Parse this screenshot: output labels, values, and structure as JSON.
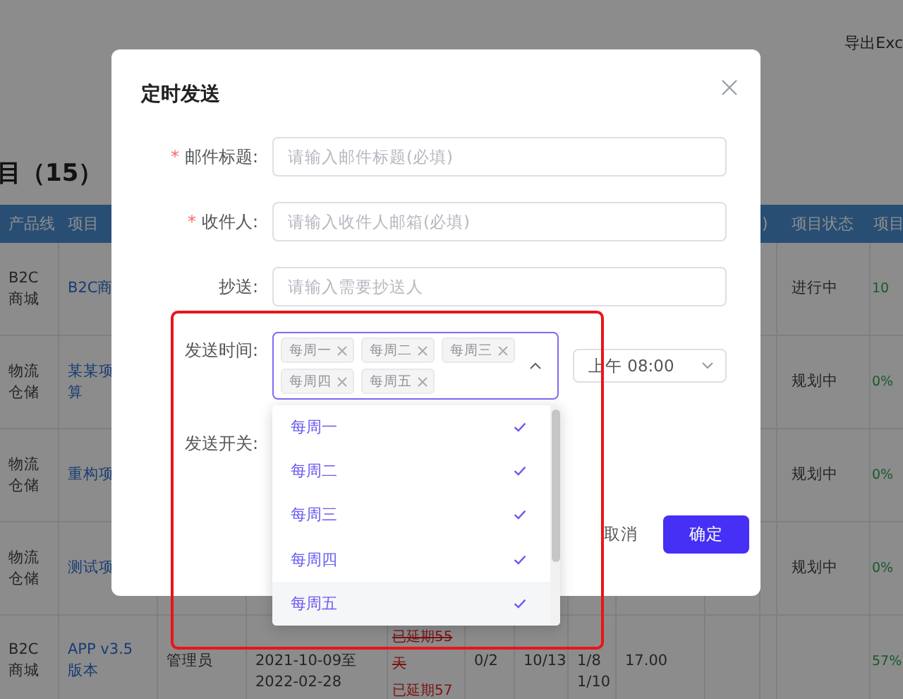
{
  "background": {
    "export_link": "导出Exc",
    "heading": "目（15）",
    "table": {
      "columns": [
        {
          "label": "产品线",
          "kind": "text"
        },
        {
          "label": "项目",
          "kind": "link"
        },
        {
          "kind": "text"
        },
        {
          "kind": "text"
        },
        {
          "kind": "delays"
        },
        {
          "kind": "text"
        },
        {
          "kind": "text"
        },
        {
          "kind": "text"
        },
        {
          "kind": "text"
        },
        {
          "kind": "text"
        },
        {
          "label": ")",
          "kind": "text"
        },
        {
          "label": "项目状态",
          "kind": "text"
        },
        {
          "label": "项目",
          "kind": "progress"
        }
      ],
      "rows": [
        {
          "cells": [
            "B2C商城",
            "B2C商",
            "",
            "",
            "",
            "",
            "",
            "",
            "",
            "",
            "",
            "进行中",
            "10"
          ]
        },
        {
          "cells": [
            "物流仓储",
            "某某项算",
            "",
            "",
            "",
            "",
            "",
            "",
            "",
            "",
            "",
            "规划中",
            "0%"
          ]
        },
        {
          "cells": [
            "物流仓储",
            "重构项",
            "",
            "",
            "",
            "",
            "",
            "",
            "",
            "",
            "",
            "规划中",
            "0%"
          ]
        },
        {
          "cells": [
            "物流仓储",
            "测试项",
            "",
            "",
            "",
            "",
            "",
            "",
            "",
            "",
            "",
            "规划中",
            "0%"
          ]
        },
        {
          "cells": [
            "B2C商城",
            "APP v3.5 版本",
            "管理员",
            "2021-10-09至 2022-02-28",
            {
              "items": [
                {
                  "text": "已延期55天",
                  "struck": true
                },
                {
                  "text": "已延期57",
                  "struck": false
                }
              ]
            },
            "0/2",
            "10/13",
            "1/8 1/10",
            "17.00",
            "",
            "",
            "",
            "57%"
          ]
        }
      ]
    }
  },
  "dialog": {
    "title": "定时发送",
    "required_mark": "*",
    "fields": [
      {
        "kind": "text",
        "label": "邮件标题:",
        "required": true,
        "placeholder": "请输入邮件标题(必填)"
      },
      {
        "kind": "text",
        "label": "收件人:",
        "required": true,
        "placeholder": "请输入收件人邮箱(必填)"
      },
      {
        "kind": "text",
        "label": "抄送:",
        "required": false,
        "placeholder": "请输入需要抄送人"
      },
      {
        "kind": "schedule",
        "label": "发送时间:",
        "required": false,
        "expanded": true,
        "tags": [
          "每周一",
          "每周二",
          "每周三",
          "每周四",
          "每周五"
        ],
        "time": "上午 08:00",
        "options": [
          {
            "label": "每周一",
            "selected": true,
            "hovered": false
          },
          {
            "label": "每周二",
            "selected": true,
            "hovered": false
          },
          {
            "label": "每周三",
            "selected": true,
            "hovered": false
          },
          {
            "label": "每周四",
            "selected": true,
            "hovered": false
          },
          {
            "label": "每周五",
            "selected": true,
            "hovered": true
          }
        ]
      },
      {
        "kind": "switch",
        "label": "发送开关:",
        "required": false
      }
    ],
    "buttons": [
      {
        "label": "取消",
        "kind": "default"
      },
      {
        "label": "确定",
        "kind": "primary"
      }
    ]
  },
  "annotation": {
    "kind": "rectangle"
  }
}
